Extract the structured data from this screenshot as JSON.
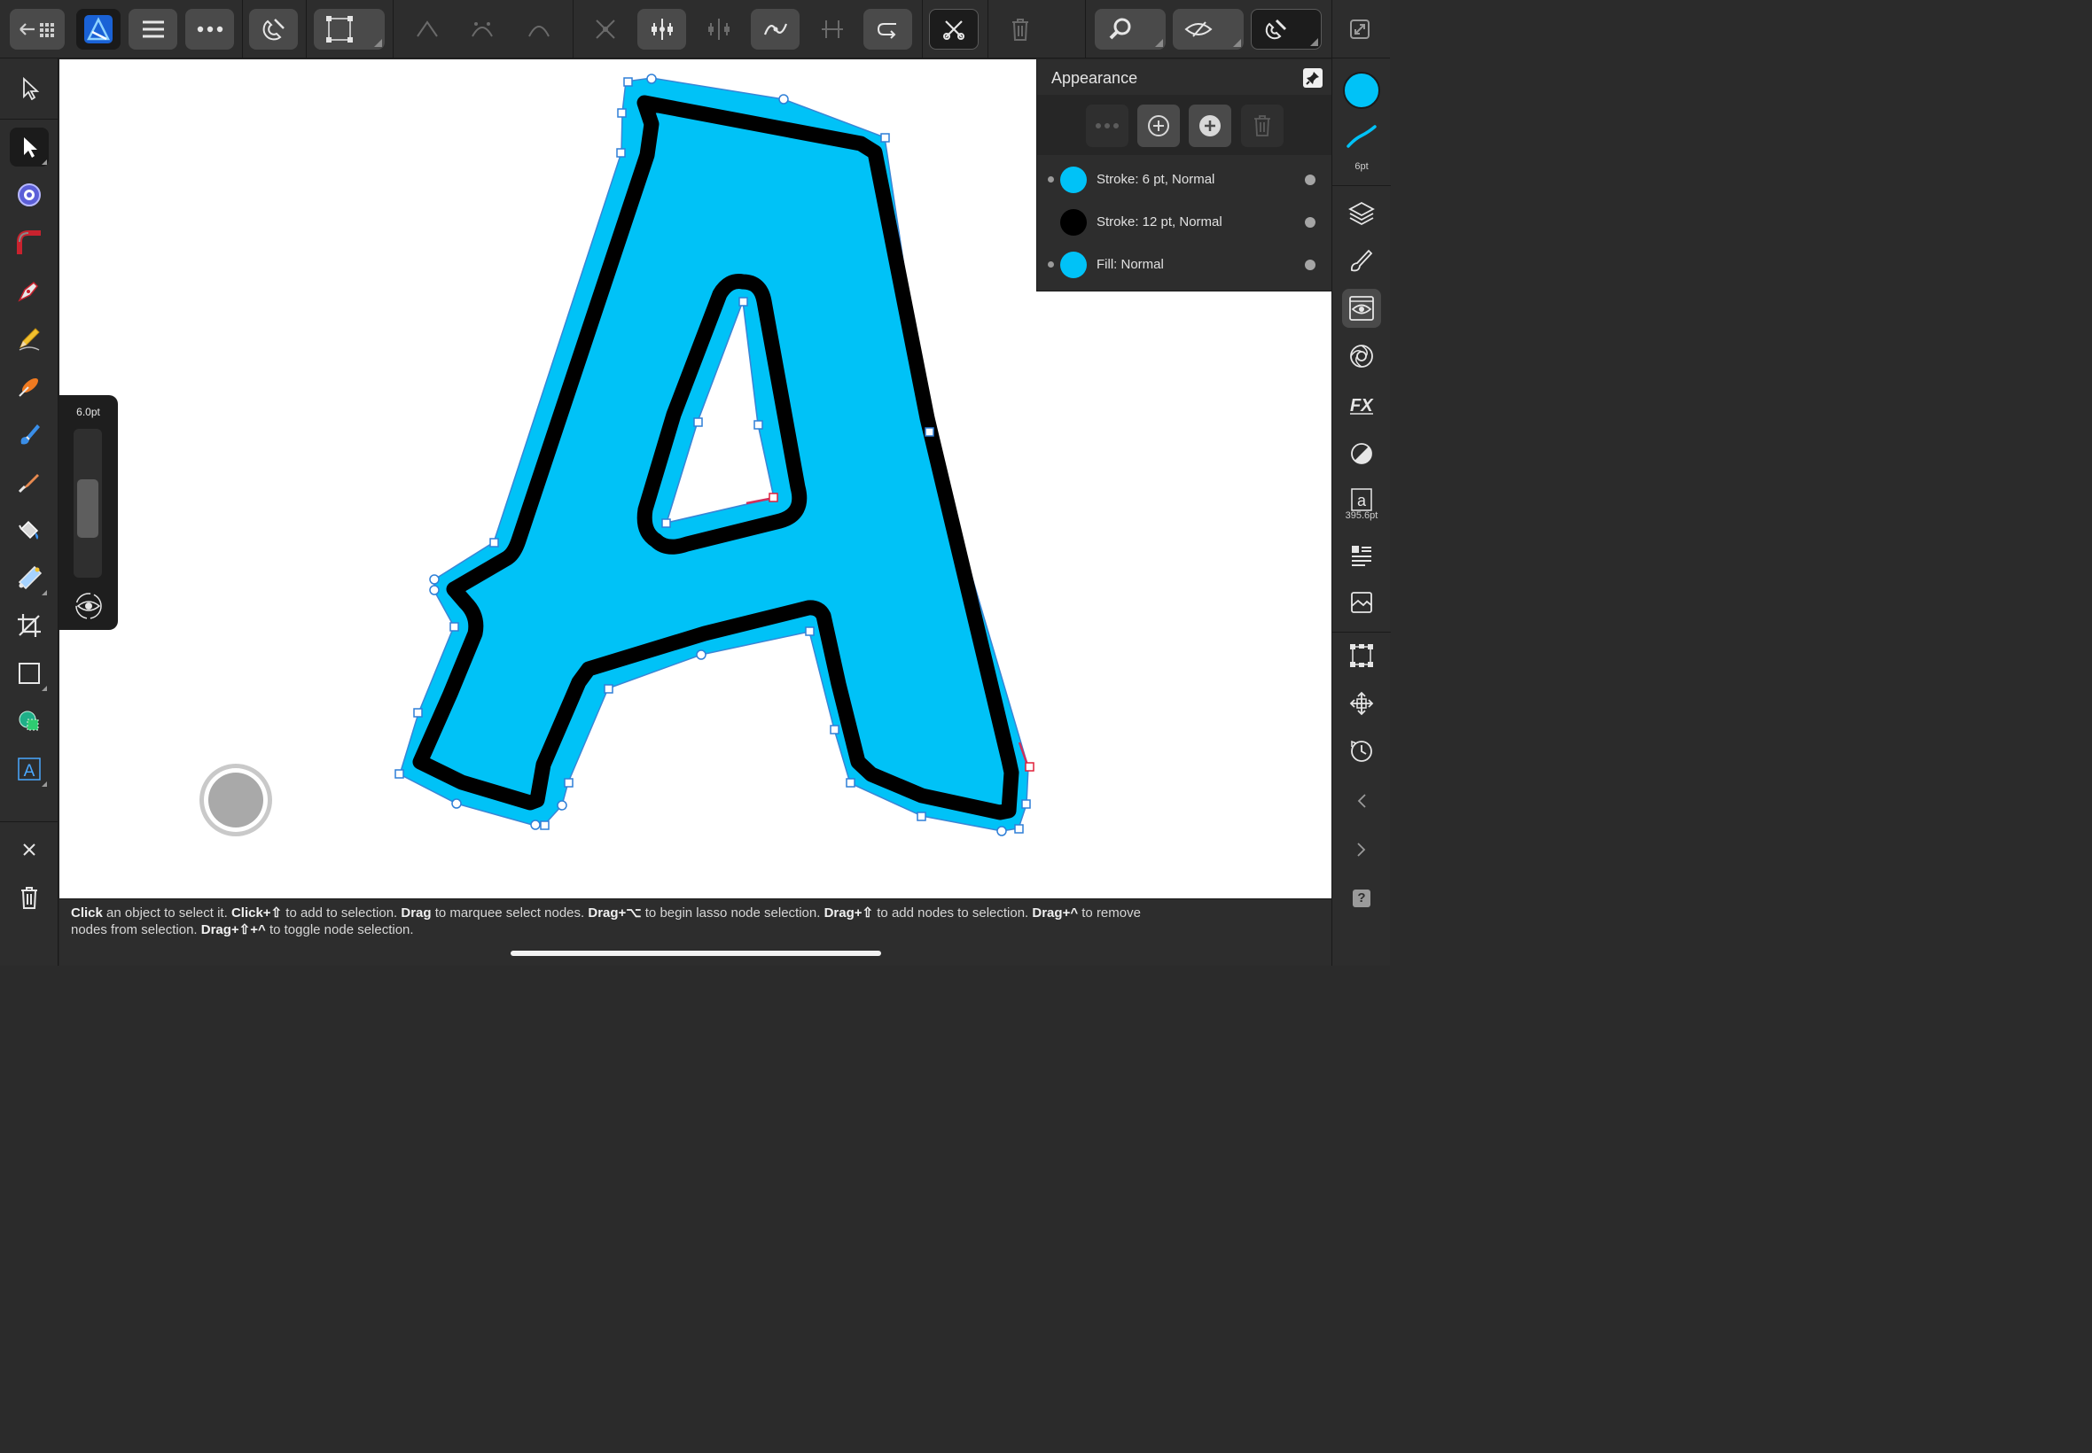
{
  "colors": {
    "accent": "#00c2f7",
    "stroke_black": "#000000",
    "canvas": "#ffffff",
    "node_outline": "#2f7fd7",
    "selected_node": "#e0203a"
  },
  "toolbar": {
    "icons": [
      "back-to-documents",
      "affinity-logo",
      "menu",
      "more",
      "snapping-magnet",
      "transform-bounding-box",
      "sharp-node",
      "smooth-node",
      "smart-node",
      "convert-to-curves",
      "align-nodes",
      "distribute-nodes",
      "smooth-curve",
      "split-nodes",
      "reverse-curve",
      "break-curve",
      "delete-node",
      "zoom",
      "view-mode",
      "snapping-toggle",
      "fullscreen"
    ]
  },
  "size_slider": {
    "value": "6.0pt",
    "level": 0.4
  },
  "appearance": {
    "title": "Appearance",
    "rows": [
      {
        "label": "Stroke: 6 pt, Normal",
        "color": "#00c2f7",
        "has_left_dot": true
      },
      {
        "label": "Stroke: 12 pt, Normal",
        "color": "#000000",
        "has_left_dot": false
      },
      {
        "label": "Fill: Normal",
        "color": "#00c2f7",
        "has_left_dot": true
      }
    ]
  },
  "right": {
    "stroke_width_label": "6pt",
    "font_size_label": "395.6pt"
  },
  "status": {
    "line1": [
      {
        "b": "Click"
      },
      {
        "t": " an object to select it. "
      },
      {
        "b": "Click+⇧"
      },
      {
        "t": " to add to selection. "
      },
      {
        "b": "Drag"
      },
      {
        "t": " to marquee select nodes. "
      },
      {
        "b": "Drag+⌥"
      },
      {
        "t": " to begin lasso node selection. "
      },
      {
        "b": "Drag+⇧"
      },
      {
        "t": " to add nodes to selection. "
      },
      {
        "b": "Drag+^"
      },
      {
        "t": " to remove"
      }
    ],
    "line2": [
      {
        "t": "nodes from selection. "
      },
      {
        "b": "Drag+⇧+^"
      },
      {
        "t": " to toggle node selection."
      }
    ]
  }
}
